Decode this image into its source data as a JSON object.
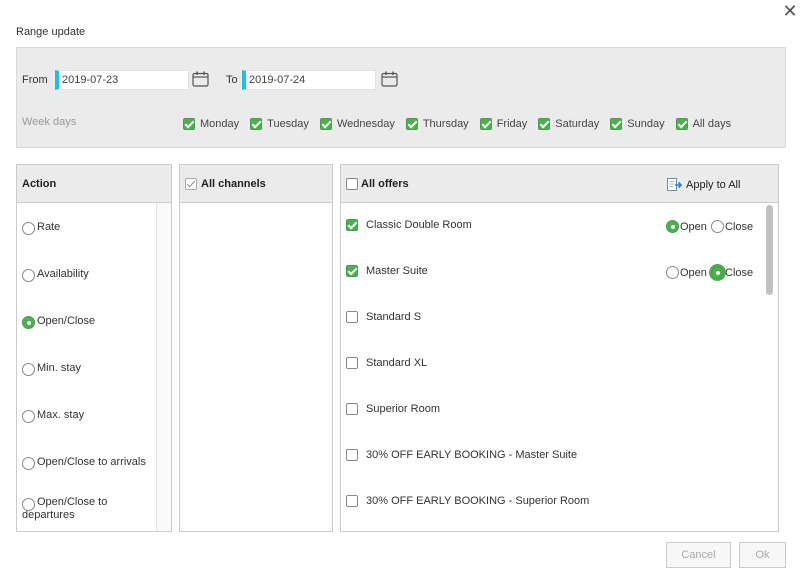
{
  "dialog": {
    "title": "Range update",
    "close_glyph": "✕"
  },
  "filter": {
    "from_label": "From",
    "from_value": "2019-07-23",
    "to_label": "To",
    "to_value": "2019-07-24",
    "weekdays_label": "Week days",
    "weekdays": [
      {
        "label": "Monday",
        "checked": true
      },
      {
        "label": "Tuesday",
        "checked": true
      },
      {
        "label": "Wednesday",
        "checked": true
      },
      {
        "label": "Thursday",
        "checked": true
      },
      {
        "label": "Friday",
        "checked": true
      },
      {
        "label": "Saturday",
        "checked": true
      },
      {
        "label": "Sunday",
        "checked": true
      },
      {
        "label": "All days",
        "checked": true
      }
    ]
  },
  "action_panel": {
    "title": "Action",
    "items": [
      {
        "label": "Rate",
        "selected": false
      },
      {
        "label": "Availability",
        "selected": false
      },
      {
        "label": "Open/Close",
        "selected": true
      },
      {
        "label": "Min. stay",
        "selected": false
      },
      {
        "label": "Max. stay",
        "selected": false
      },
      {
        "label": "Open/Close to arrivals",
        "selected": false
      },
      {
        "label": "Open/Close to departures",
        "selected": false
      }
    ]
  },
  "channels_panel": {
    "title": "All channels",
    "checked": true
  },
  "offers_panel": {
    "title": "All offers",
    "apply_label": "Apply to All",
    "open_label": "Open",
    "close_label": "Close",
    "offers": [
      {
        "label": "Classic Double Room",
        "checked": true,
        "state": "open"
      },
      {
        "label": "Master Suite",
        "checked": true,
        "state": "close"
      },
      {
        "label": "Standard S",
        "checked": false
      },
      {
        "label": "Standard XL",
        "checked": false
      },
      {
        "label": "Superior Room",
        "checked": false
      },
      {
        "label": "30% OFF EARLY BOOKING - Master Suite",
        "checked": false
      },
      {
        "label": "30% OFF EARLY BOOKING - Superior Room",
        "checked": false
      }
    ]
  },
  "footer": {
    "cancel_label": "Cancel",
    "ok_label": "Ok"
  },
  "colors": {
    "accent": "#4caf50",
    "date_marker": "#16c5e6",
    "panel_bg": "#ebebeb"
  }
}
